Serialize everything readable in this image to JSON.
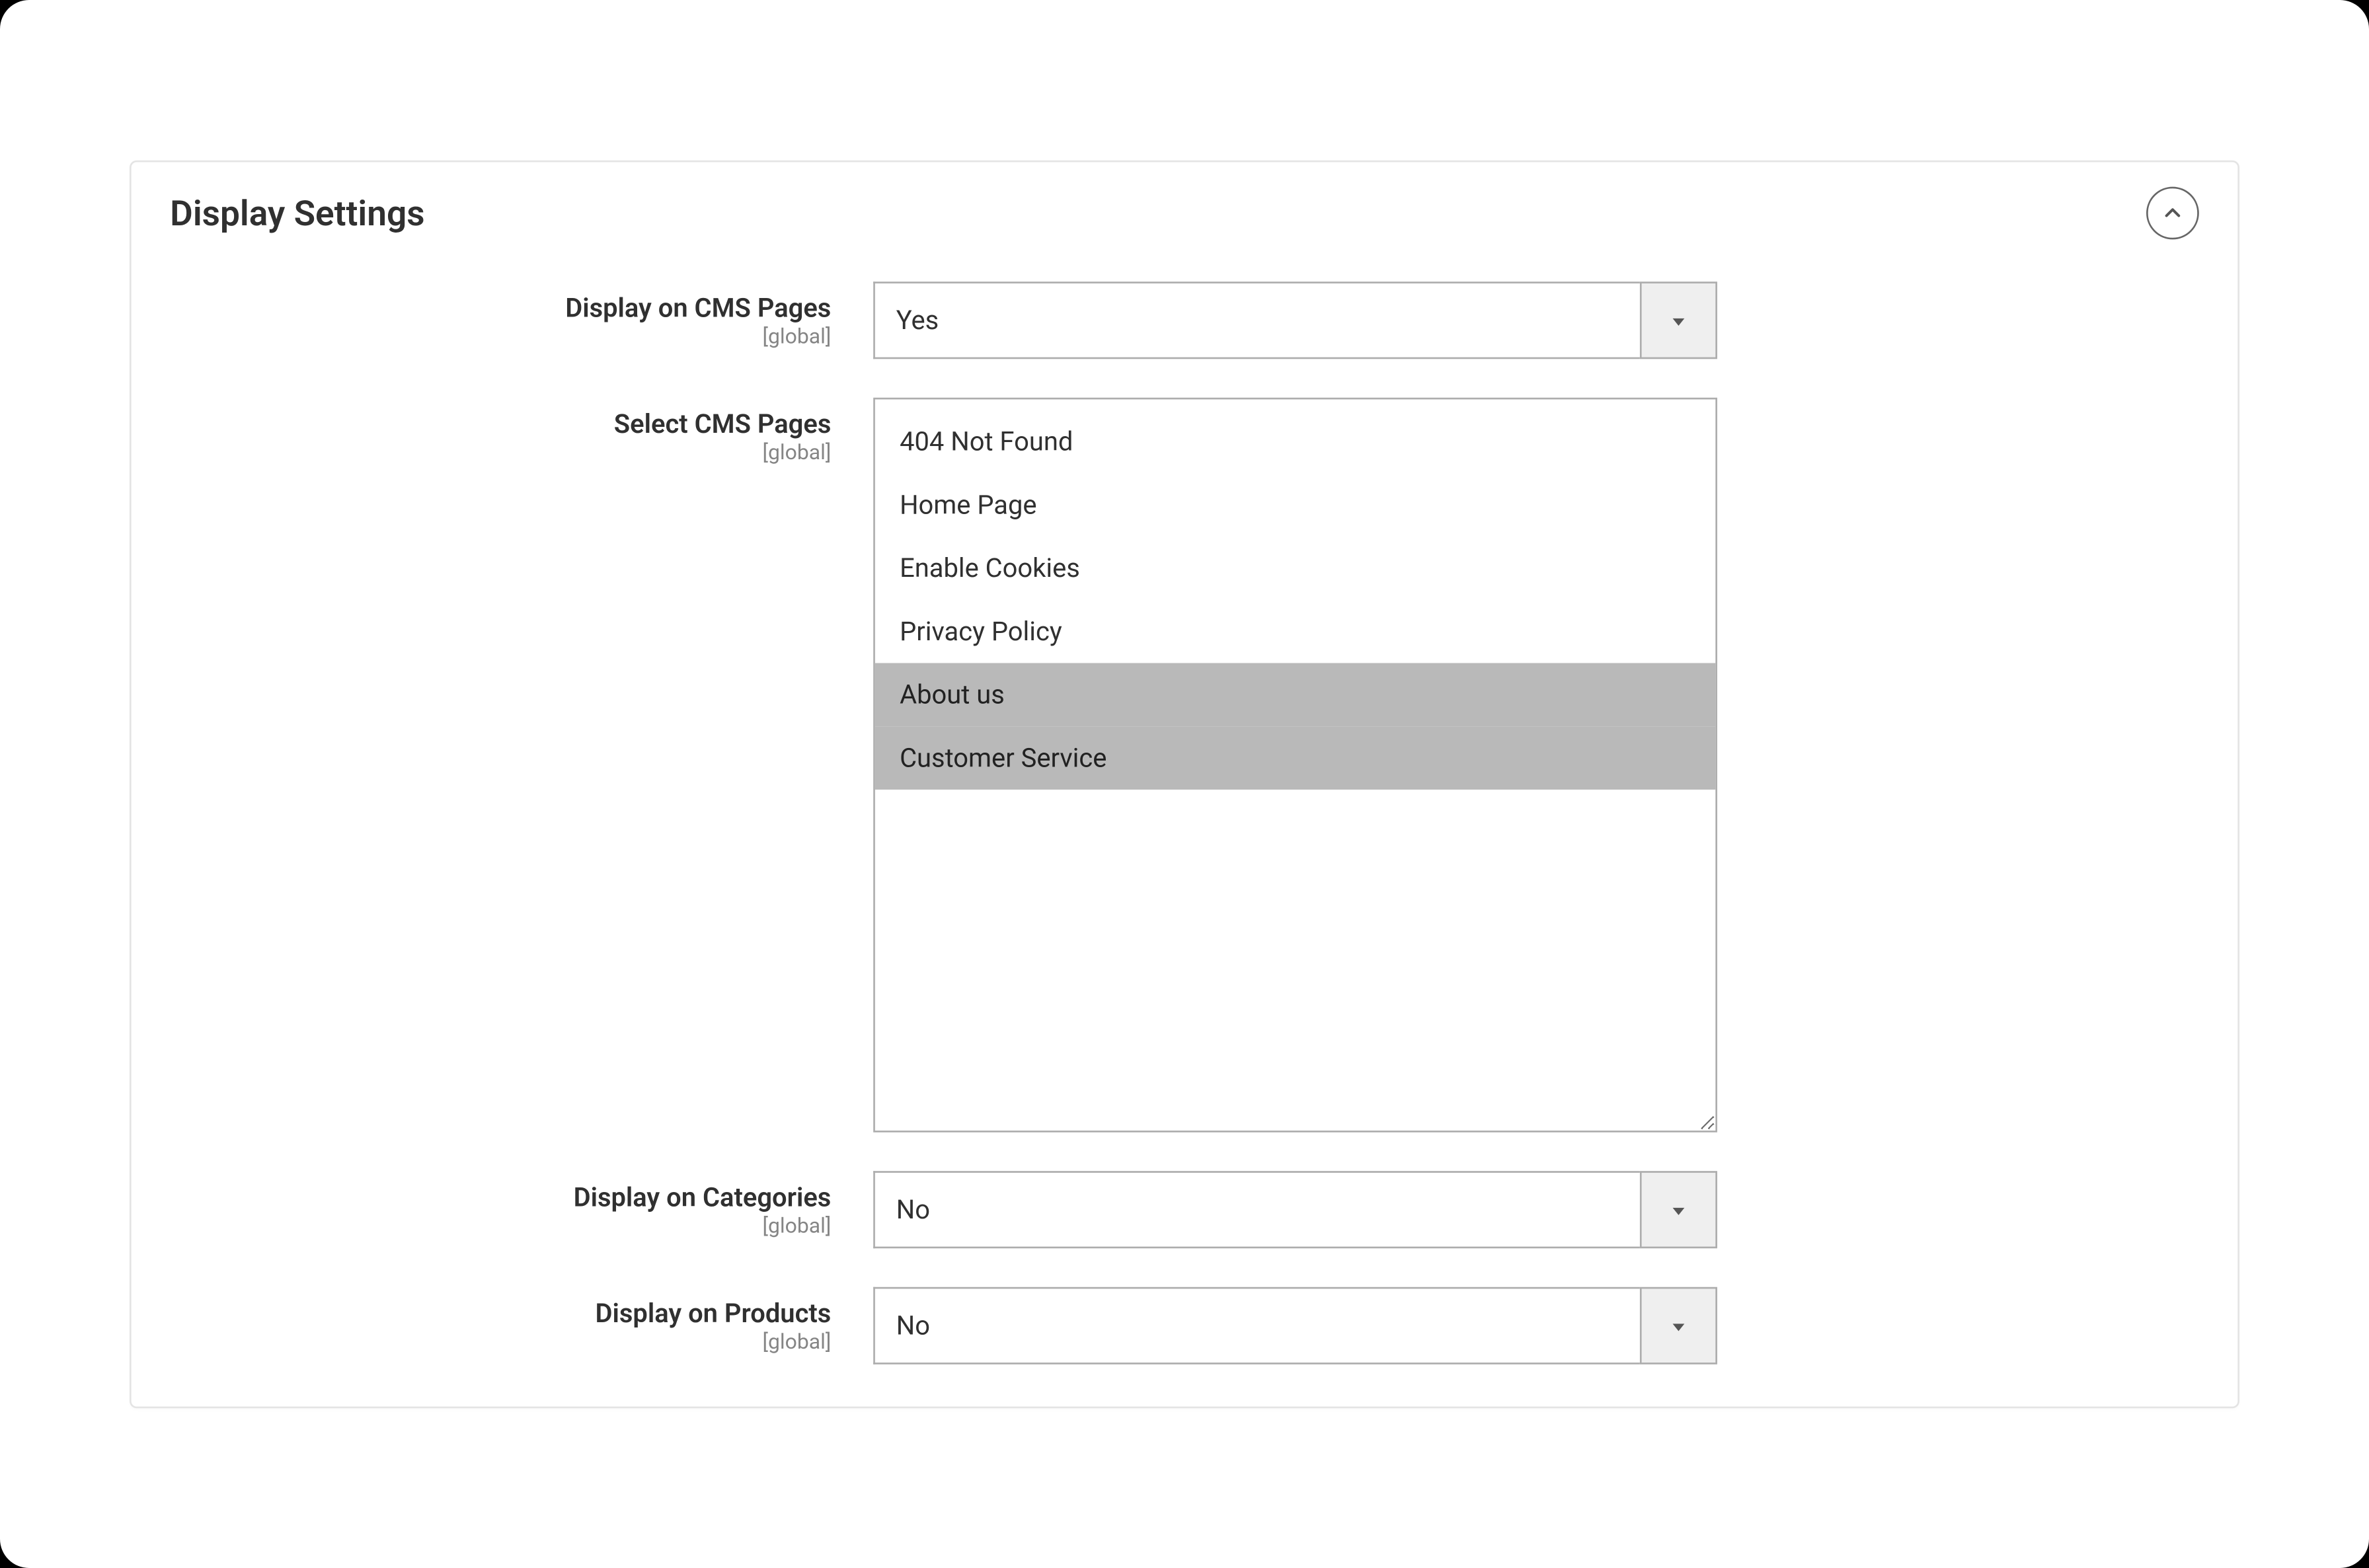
{
  "section": {
    "title": "Display Settings"
  },
  "scope_label": "[global]",
  "fields": {
    "display_cms": {
      "label": "Display on CMS Pages",
      "value": "Yes"
    },
    "select_cms": {
      "label": "Select CMS Pages",
      "options": [
        {
          "label": "404 Not Found",
          "selected": false
        },
        {
          "label": "Home Page",
          "selected": false
        },
        {
          "label": "Enable Cookies",
          "selected": false
        },
        {
          "label": "Privacy Policy",
          "selected": false
        },
        {
          "label": "About us",
          "selected": true
        },
        {
          "label": "Customer Service",
          "selected": true
        }
      ]
    },
    "display_categories": {
      "label": "Display on Categories",
      "value": "No"
    },
    "display_products": {
      "label": "Display on Products",
      "value": "No"
    }
  }
}
